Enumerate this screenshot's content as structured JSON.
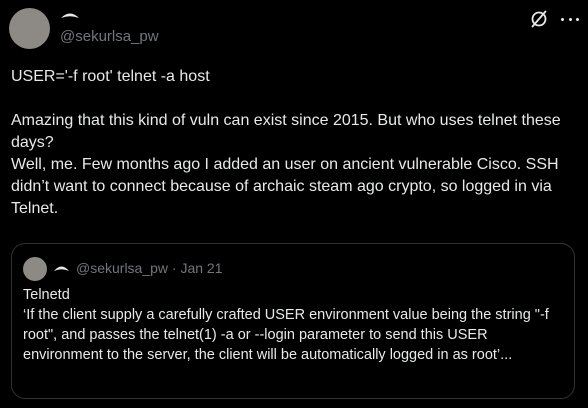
{
  "author": {
    "handle": "@sekurlsa_pw"
  },
  "post": {
    "lines": [
      "USER='-f root' telnet -a host",
      "",
      "Amazing that this kind of vuln can exist since 2015. But who uses telnet these days?",
      "Well, me. Few months ago I added an user on ancient vulnerable Cisco. SSH didn’t want to connect because of archaic steam ago crypto, so logged in via Telnet."
    ]
  },
  "quote": {
    "handle": "@sekurlsa_pw",
    "separator": "·",
    "date": "Jan 21",
    "meta": "@sekurlsa_pw · Jan 21",
    "title": "Telnetd",
    "text": "‘If the client supply a carefully crafted USER environment value being the string \"-f root\", and passes the telnet(1) -a or --login parameter to send this USER environment to the server, the client will be automatically logged in as root’..."
  },
  "icons": {
    "grok": "grok-icon",
    "more": "more-icon",
    "name_glyph": "dark-lens-icon"
  },
  "colors": {
    "background": "#000000",
    "text": "#e7e9ea",
    "secondary": "#71767b",
    "border": "#2f3336",
    "avatar": "#8d8a85"
  }
}
